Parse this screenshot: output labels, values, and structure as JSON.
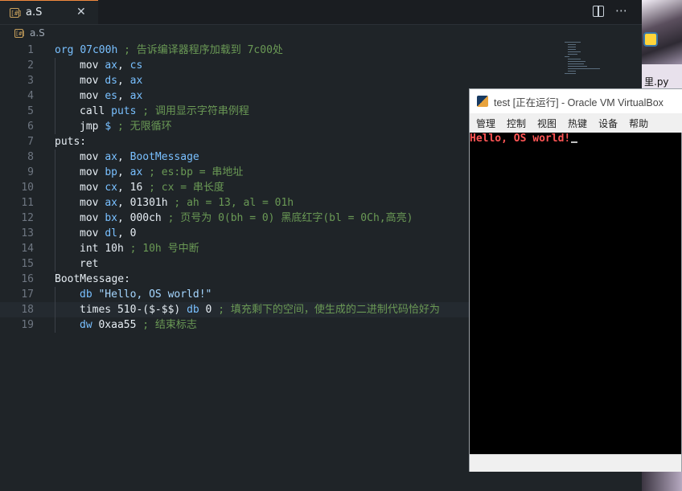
{
  "editor": {
    "tab_name": "a.S",
    "tab_icon": "asm-file-icon",
    "tab_close": "✕",
    "actions": {
      "split": "split-editor-icon",
      "more": "⋯"
    },
    "breadcrumb": "a.S",
    "lines": [
      {
        "n": "1",
        "indent": false,
        "tokens": [
          [
            "kw",
            "org "
          ],
          [
            "kw",
            "07c00h"
          ],
          [
            "cm",
            " ; 告诉编译器程序加载到 7c00处"
          ]
        ]
      },
      {
        "n": "2",
        "indent": true,
        "tokens": [
          [
            "ins",
            "mov "
          ],
          [
            "kw",
            "ax"
          ],
          [
            "op",
            ", "
          ],
          [
            "kw",
            "cs"
          ]
        ]
      },
      {
        "n": "3",
        "indent": true,
        "tokens": [
          [
            "ins",
            "mov "
          ],
          [
            "kw",
            "ds"
          ],
          [
            "op",
            ", "
          ],
          [
            "kw",
            "ax"
          ]
        ]
      },
      {
        "n": "4",
        "indent": true,
        "tokens": [
          [
            "ins",
            "mov "
          ],
          [
            "kw",
            "es"
          ],
          [
            "op",
            ", "
          ],
          [
            "kw",
            "ax"
          ]
        ]
      },
      {
        "n": "5",
        "indent": true,
        "tokens": [
          [
            "ins",
            "call "
          ],
          [
            "kw",
            "puts"
          ],
          [
            "cm",
            " ; 调用显示字符串例程"
          ]
        ]
      },
      {
        "n": "6",
        "indent": true,
        "tokens": [
          [
            "ins",
            "jmp "
          ],
          [
            "kw",
            "$"
          ],
          [
            "cm",
            " ; 无限循环"
          ]
        ]
      },
      {
        "n": "7",
        "indent": false,
        "tokens": [
          [
            "lb",
            "puts:"
          ]
        ]
      },
      {
        "n": "8",
        "indent": true,
        "tokens": [
          [
            "ins",
            "mov "
          ],
          [
            "kw",
            "ax"
          ],
          [
            "op",
            ", "
          ],
          [
            "kw",
            "BootMessage"
          ]
        ]
      },
      {
        "n": "9",
        "indent": true,
        "tokens": [
          [
            "ins",
            "mov "
          ],
          [
            "kw",
            "bp"
          ],
          [
            "op",
            ", "
          ],
          [
            "kw",
            "ax"
          ],
          [
            "cm",
            " ; es:bp = 串地址"
          ]
        ]
      },
      {
        "n": "10",
        "indent": true,
        "tokens": [
          [
            "ins",
            "mov "
          ],
          [
            "kw",
            "cx"
          ],
          [
            "op",
            ", "
          ],
          [
            "ins",
            "16"
          ],
          [
            "cm",
            " ; cx = 串长度"
          ]
        ]
      },
      {
        "n": "11",
        "indent": true,
        "tokens": [
          [
            "ins",
            "mov "
          ],
          [
            "kw",
            "ax"
          ],
          [
            "op",
            ", "
          ],
          [
            "ins",
            "01301h"
          ],
          [
            "cm",
            " ; ah = 13, al = 01h"
          ]
        ]
      },
      {
        "n": "12",
        "indent": true,
        "tokens": [
          [
            "ins",
            "mov "
          ],
          [
            "kw",
            "bx"
          ],
          [
            "op",
            ", "
          ],
          [
            "ins",
            "000ch"
          ],
          [
            "cm",
            " ; 页号为 0(bh = 0) 黑底红字(bl = 0Ch,高亮)"
          ]
        ]
      },
      {
        "n": "13",
        "indent": true,
        "tokens": [
          [
            "ins",
            "mov "
          ],
          [
            "kw",
            "dl"
          ],
          [
            "op",
            ", "
          ],
          [
            "ins",
            "0"
          ]
        ]
      },
      {
        "n": "14",
        "indent": true,
        "tokens": [
          [
            "ins",
            "int "
          ],
          [
            "ins",
            "10h"
          ],
          [
            "cm",
            " ; 10h 号中断"
          ]
        ]
      },
      {
        "n": "15",
        "indent": true,
        "tokens": [
          [
            "ins",
            "ret"
          ]
        ]
      },
      {
        "n": "16",
        "indent": false,
        "tokens": [
          [
            "lb",
            "BootMessage:"
          ]
        ]
      },
      {
        "n": "17",
        "indent": true,
        "tokens": [
          [
            "kw",
            "db "
          ],
          [
            "str",
            "\"Hello, OS world!\""
          ]
        ]
      },
      {
        "n": "18",
        "indent": true,
        "tokens": [
          [
            "ins",
            "times "
          ],
          [
            "ins",
            "510-($-$$) "
          ],
          [
            "kw",
            "db "
          ],
          [
            "ins",
            "0"
          ],
          [
            "cm",
            " ; 填充剩下的空间，使生成的二进制代码恰好为"
          ]
        ]
      },
      {
        "n": "19",
        "indent": true,
        "tokens": [
          [
            "kw",
            "dw "
          ],
          [
            "ins",
            "0xaa55"
          ],
          [
            "cm",
            " ; 结束标志"
          ]
        ]
      }
    ],
    "current_line": "18"
  },
  "desktop": {
    "label": "里.py"
  },
  "vbox": {
    "title": "test [正在运行] - Oracle VM VirtualBox",
    "menu": [
      "管理",
      "控制",
      "视图",
      "热键",
      "设备",
      "帮助"
    ],
    "screen_output": "Hello, OS world!",
    "screen_color": "#ff5555"
  }
}
